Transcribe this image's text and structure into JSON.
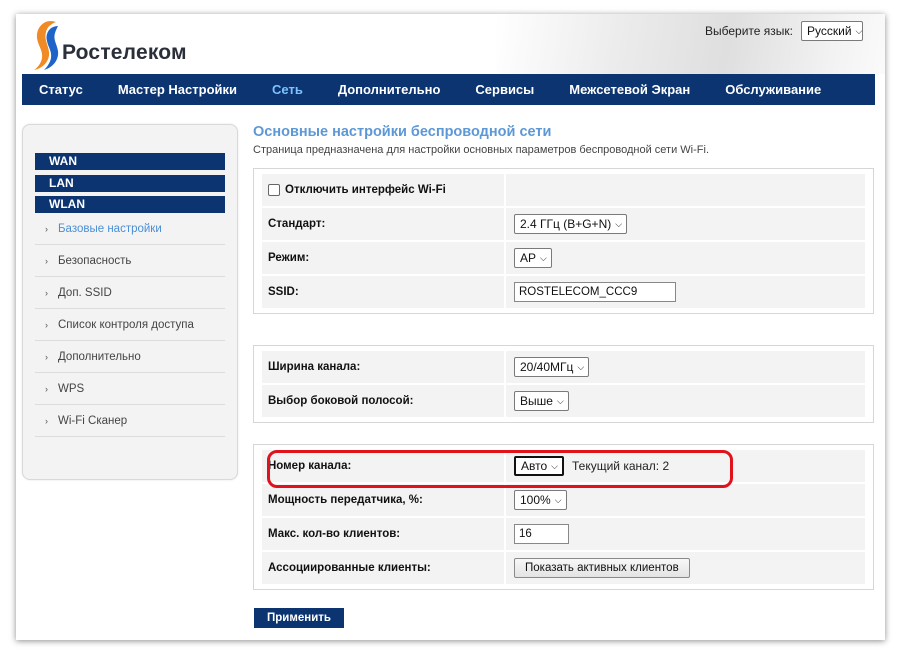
{
  "brand": {
    "name": "Ростелеком",
    "colors": {
      "orange": "#f08a24",
      "blue": "#1e64c8",
      "navy": "#0b3470",
      "accent": "#7cc2ff"
    }
  },
  "language": {
    "label": "Выберите язык:",
    "value": "Русский"
  },
  "nav": [
    {
      "label": "Статус"
    },
    {
      "label": "Мастер Настройки"
    },
    {
      "label": "Сеть"
    },
    {
      "label": "Дополнительно"
    },
    {
      "label": "Сервисы"
    },
    {
      "label": "Межсетевой Экран"
    },
    {
      "label": "Обслуживание"
    }
  ],
  "sidebar": {
    "groups": [
      "WAN",
      "LAN",
      "WLAN"
    ],
    "items": [
      {
        "label": "Базовые настройки"
      },
      {
        "label": "Безопасность"
      },
      {
        "label": "Доп. SSID"
      },
      {
        "label": "Список контроля доступа"
      },
      {
        "label": "Дополнительно"
      },
      {
        "label": "WPS"
      },
      {
        "label": "Wi-Fi Сканер"
      }
    ]
  },
  "page": {
    "title": "Основные настройки беспроводной сети",
    "description": "Страница предназначена для настройки основных параметров беспроводной сети Wi-Fi."
  },
  "form": {
    "disable_wifi": {
      "label": "Отключить интерфейс Wi-Fi"
    },
    "standard": {
      "label": "Стандарт:",
      "value": "2.4 ГГц (B+G+N)"
    },
    "mode": {
      "label": "Режим:",
      "value": "AP"
    },
    "ssid": {
      "label": "SSID:",
      "value": "ROSTELECOM_CCC9"
    },
    "channel_width": {
      "label": "Ширина канала:",
      "value": "20/40МГц"
    },
    "sideband": {
      "label": "Выбор боковой полосой:",
      "value": "Выше"
    },
    "channel": {
      "label": "Номер канала:",
      "value": "Авто",
      "current": "Текущий канал: 2"
    },
    "tx_power": {
      "label": "Мощность передатчика, %:",
      "value": "100%"
    },
    "max_clients": {
      "label": "Макс. кол-во клиентов:",
      "value": "16"
    },
    "assoc_clients": {
      "label": "Ассоциированные клиенты:",
      "button": "Показать активных клиентов"
    },
    "apply": "Применить"
  }
}
